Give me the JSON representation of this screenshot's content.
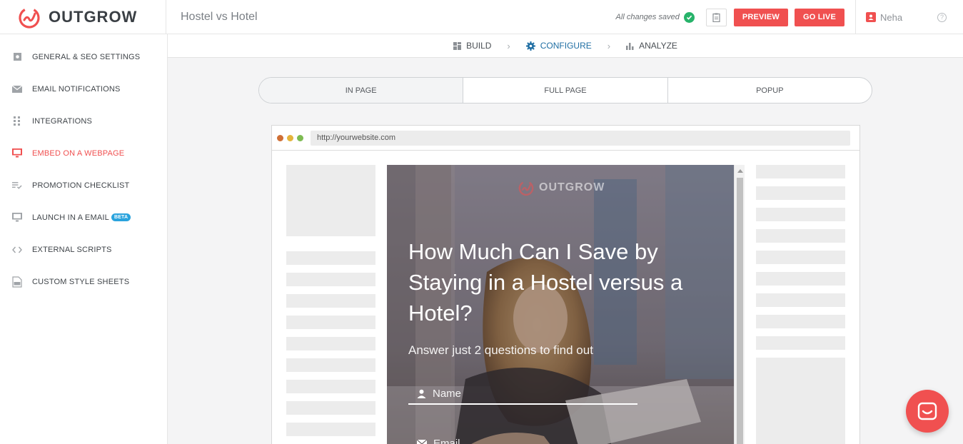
{
  "app": {
    "brand": "OUTGROW",
    "project_title": "Hostel vs Hotel",
    "status": "All changes saved",
    "preview_label": "PREVIEW",
    "golive_label": "GO LIVE",
    "user_name": "Neha",
    "accent_color": "#f05050"
  },
  "steps": [
    {
      "label": "BUILD",
      "icon": "grid-icon"
    },
    {
      "label": "CONFIGURE",
      "icon": "gear-icon",
      "active": true
    },
    {
      "label": "ANALYZE",
      "icon": "bar-chart-icon"
    }
  ],
  "sidebar": {
    "items": [
      {
        "label": "GENERAL & SEO SETTINGS",
        "icon": "settings-box-icon"
      },
      {
        "label": "EMAIL NOTIFICATIONS",
        "icon": "envelope-icon"
      },
      {
        "label": "INTEGRATIONS",
        "icon": "dots-grid-icon"
      },
      {
        "label": "EMBED ON A WEBPAGE",
        "icon": "monitor-icon",
        "active": true
      },
      {
        "label": "PROMOTION CHECKLIST",
        "icon": "checklist-icon"
      },
      {
        "label": "LAUNCH IN A EMAIL",
        "icon": "monitor-icon",
        "badge": "BETA"
      },
      {
        "label": "EXTERNAL SCRIPTS",
        "icon": "code-icon"
      },
      {
        "label": "CUSTOM STYLE SHEETS",
        "icon": "css-file-icon"
      }
    ]
  },
  "embed_tabs": [
    {
      "label": "IN PAGE",
      "active": true
    },
    {
      "label": "FULL PAGE"
    },
    {
      "label": "POPUP"
    }
  ],
  "browser": {
    "url": "http://yourwebsite.com"
  },
  "calculator": {
    "brand": "OUTGROW",
    "headline": "How Much Can I Save by Staying in a Hostel versus a Hotel?",
    "subheadline": "Answer just 2 questions to find out",
    "name_placeholder": "Name",
    "email_placeholder": "Email"
  }
}
